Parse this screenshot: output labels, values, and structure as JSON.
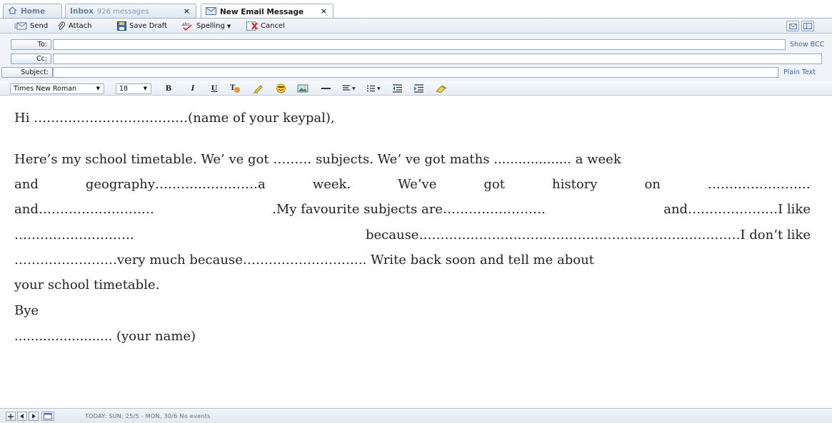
{
  "tabs": [
    {
      "label": "Home",
      "sub": ""
    },
    {
      "label": "Inbox",
      "sub": "926 messages",
      "close": "×"
    },
    {
      "label": "New Email Message",
      "sub": "",
      "close": "×"
    }
  ],
  "toolbar": {
    "send": "Send",
    "attach": "Attach",
    "save_draft": "Save Draft",
    "spelling": "Spelling",
    "cancel": "Cancel"
  },
  "fields": {
    "to_label": "To:",
    "cc_label": "Cc:",
    "subject_label": "Subject:",
    "to_value": "",
    "cc_value": "",
    "subject_value": "",
    "show_bcc": "Show BCC",
    "plain_text": "Plain Text"
  },
  "format": {
    "font_family": "Times New Roman",
    "font_size": "18",
    "bold": "B",
    "italic": "I",
    "underline": "U"
  },
  "body": {
    "line1": "Hi ………………………………(name of your keypal),",
    "line2": [
      "Here’s my school timetable. We’ ve got ……… subjects. We’ ve got maths ................... a week"
    ],
    "line3": [
      "and",
      "geography……………………a",
      "week.",
      "We’ve",
      "got",
      "history",
      "on",
      "……………………"
    ],
    "line4": [
      "and………………………",
      ".My favourite subjects are……………………",
      "and…………………I like"
    ],
    "line5": [
      "……………………….",
      "because…………………………………………………………………I don’t like"
    ],
    "line6": [
      "……………………very much because……………………….. Write back soon and tell me about"
    ],
    "line7": "your school timetable.",
    "line8": "Bye",
    "line9": "........................ (your name)"
  },
  "status": {
    "text": "TODAY: SUN, 25/5 - MON, 30/6  No events"
  },
  "colors": {
    "tab_border": "#9bb2cc",
    "toolbar_bg": "#e4ebf3",
    "link": "#3b66a8"
  }
}
